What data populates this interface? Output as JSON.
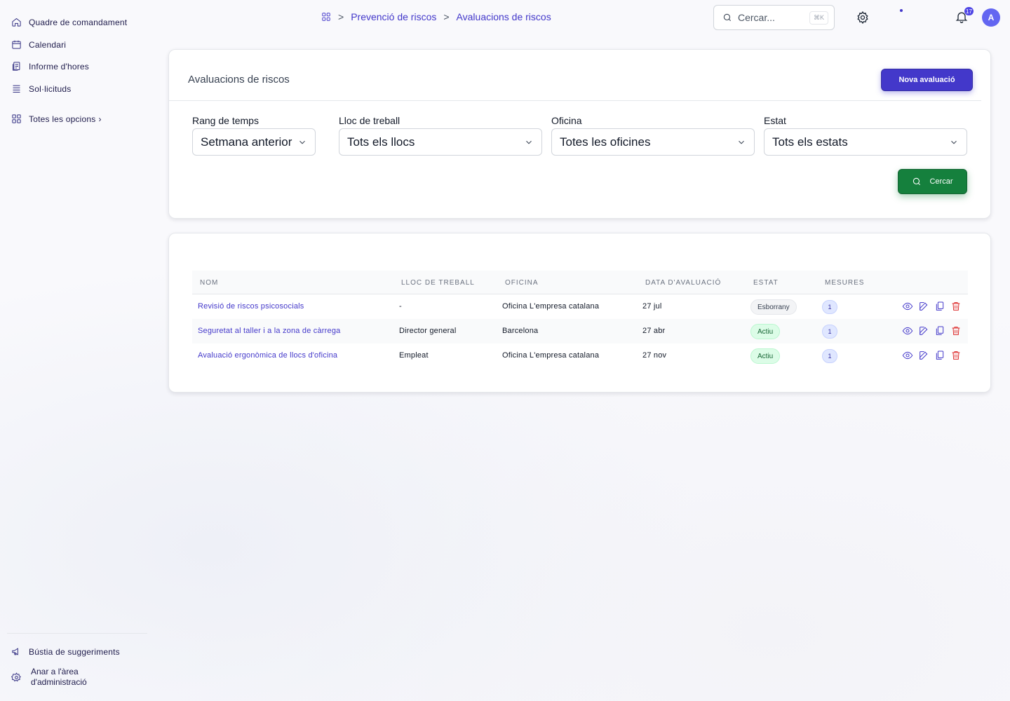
{
  "sidebar": {
    "items": [
      {
        "label": "Quadre de comandament",
        "icon": "home-icon"
      },
      {
        "label": "Calendari",
        "icon": "calendar-icon"
      },
      {
        "label": "Informe d'hores",
        "icon": "report-icon"
      },
      {
        "label": "Sol·licituds",
        "icon": "list-icon"
      }
    ],
    "all_options": "Totes les opcions",
    "suggestions": "Bústia de suggeriments",
    "admin_line1": "Anar a l'àrea",
    "admin_line2": "d'administració"
  },
  "breadcrumb": {
    "items": [
      "Prevenció de riscos",
      "Avaluacions de riscos"
    ],
    "separator": ">"
  },
  "search": {
    "placeholder": "Cercar...",
    "shortcut": "⌘K"
  },
  "notifications": {
    "count": "17"
  },
  "user": {
    "initial": "A"
  },
  "filters_card": {
    "title": "Avaluacions de riscos",
    "new_button": "Nova avaluació",
    "filters": [
      {
        "label": "Rang de temps",
        "value": "Setmana anterior"
      },
      {
        "label": "Lloc de treball",
        "value": "Tots els llocs"
      },
      {
        "label": "Oficina",
        "value": "Totes les oficines"
      },
      {
        "label": "Estat",
        "value": "Tots els estats"
      }
    ],
    "search_button": "Cercar"
  },
  "table": {
    "columns": [
      "NOM",
      "LLOC DE TREBALL",
      "OFICINA",
      "DATA D'AVALUACIÓ",
      "ESTAT",
      "MESURES"
    ],
    "rows": [
      {
        "name": "Revisió de riscos psicosocials",
        "workplace": "-",
        "office": "Oficina L'empresa catalana",
        "date": "27 jul",
        "status": "Esborrany",
        "measures": "1"
      },
      {
        "name": "Seguretat al taller i a la zona de càrrega",
        "workplace": "Director general",
        "office": "Barcelona",
        "date": "27 abr",
        "status": "Actiu",
        "measures": "1"
      },
      {
        "name": "Avaluació ergonòmica de llocs d'oficina",
        "workplace": "Empleat",
        "office": "Oficina L'empresa catalana",
        "date": "27 nov",
        "status": "Actiu",
        "measures": "1"
      }
    ]
  },
  "colors": {
    "accent": "#4338ca",
    "success": "#15803d",
    "danger": "#dc2626"
  }
}
